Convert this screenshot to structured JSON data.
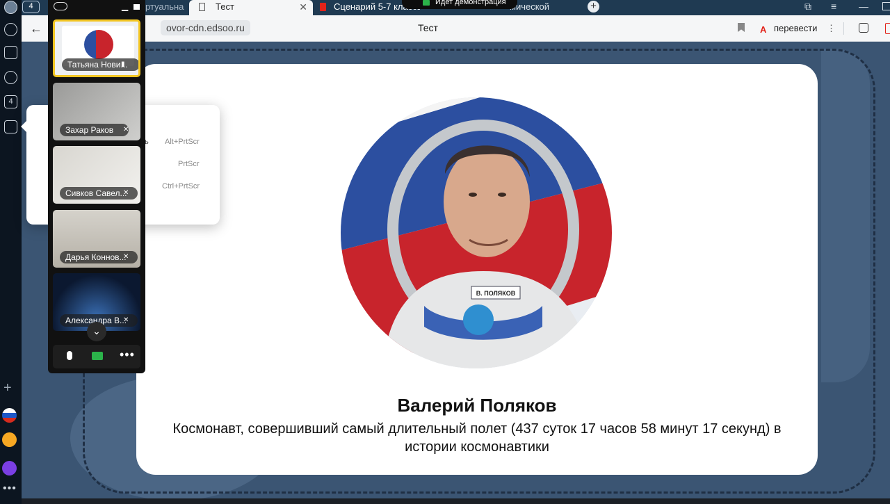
{
  "browser": {
    "tab_count_badge": "4",
    "tabs": [
      {
        "label": "ртуальная",
        "active": false
      },
      {
        "label": "Тест",
        "active": true
      },
      {
        "label": "Сценарий 5-7 классы",
        "active": false
      },
      {
        "label": "мической",
        "active": false
      }
    ],
    "demo_status": "Идет демонстрация",
    "address": {
      "url": "ovor-cdn.edsoo.ru",
      "page_title": "Тест",
      "translate_label": "перевести"
    }
  },
  "rail": {
    "tab_badge": "4"
  },
  "screenshot_menu": {
    "partial_label": "ь",
    "shortcuts": [
      "Alt+PrtScr",
      "PrtScr",
      "Ctrl+PrtScr"
    ]
  },
  "call_panel": {
    "participants": [
      {
        "name": "Татьяна Нови...",
        "speaking": true
      },
      {
        "name": "Захар Раков",
        "speaking": false
      },
      {
        "name": "Сивков Савел...",
        "speaking": false
      },
      {
        "name": "Дарья Коннов...",
        "speaking": false
      },
      {
        "name": "Александра В...",
        "speaking": false
      }
    ]
  },
  "slide": {
    "name": "Валерий Поляков",
    "description": "Космонавт, совершивший самый длительный полет (437 суток 17 часов 58 минут 17 секунд) в истории космонавтики",
    "badge_text": "В. ПОЛЯКОВ"
  }
}
